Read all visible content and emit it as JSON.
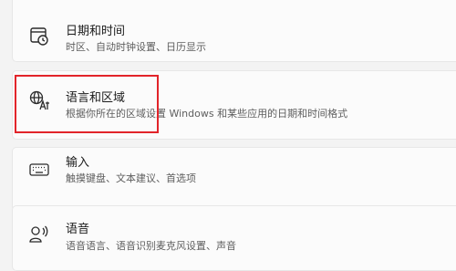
{
  "settings": {
    "items": [
      {
        "title": "日期和时间",
        "subtitle": "时区、自动时钟设置、日历显示",
        "icon": "clock-calendar-icon"
      },
      {
        "title": "语言和区域",
        "subtitle": "根据你所在的区域设置 Windows 和某些应用的日期和时间格式",
        "icon": "language-region-icon"
      },
      {
        "title": "输入",
        "subtitle": "触摸键盘、文本建议、首选项",
        "icon": "keyboard-icon"
      },
      {
        "title": "语音",
        "subtitle": "语音语言、语音识别麦克风设置、声音",
        "icon": "speech-icon"
      }
    ]
  },
  "annotation": {
    "highlight_color": "#e2242a"
  }
}
